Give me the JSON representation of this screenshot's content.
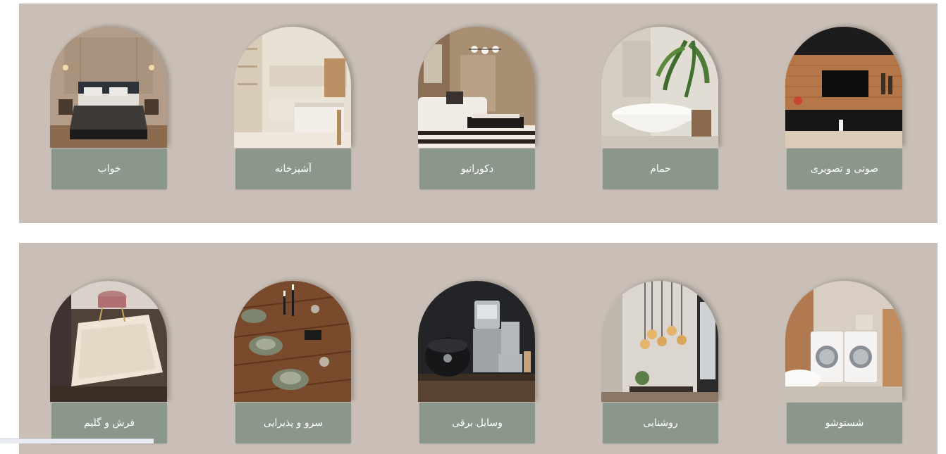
{
  "categories_top": [
    {
      "label": "خواب",
      "image": "bedroom-image"
    },
    {
      "label": "آشپزخانه",
      "image": "kitchen-image"
    },
    {
      "label": "دکوراتیو",
      "image": "living-room-image"
    },
    {
      "label": "حمام",
      "image": "bathroom-image"
    },
    {
      "label": "صوتی و تصویری",
      "image": "tv-unit-image"
    }
  ],
  "categories_bottom": [
    {
      "label": "فرش و گلیم",
      "image": "rug-image"
    },
    {
      "label": "سرو و پذیرایی",
      "image": "dining-table-image"
    },
    {
      "label": "وسایل برقی",
      "image": "appliances-image"
    },
    {
      "label": "روشنایی",
      "image": "pendant-lights-image"
    },
    {
      "label": "شستوشو",
      "image": "laundry-room-image"
    }
  ],
  "colors": {
    "panel": "#c9bfb6",
    "button": "#8b978a",
    "button_text": "#ffffff"
  }
}
